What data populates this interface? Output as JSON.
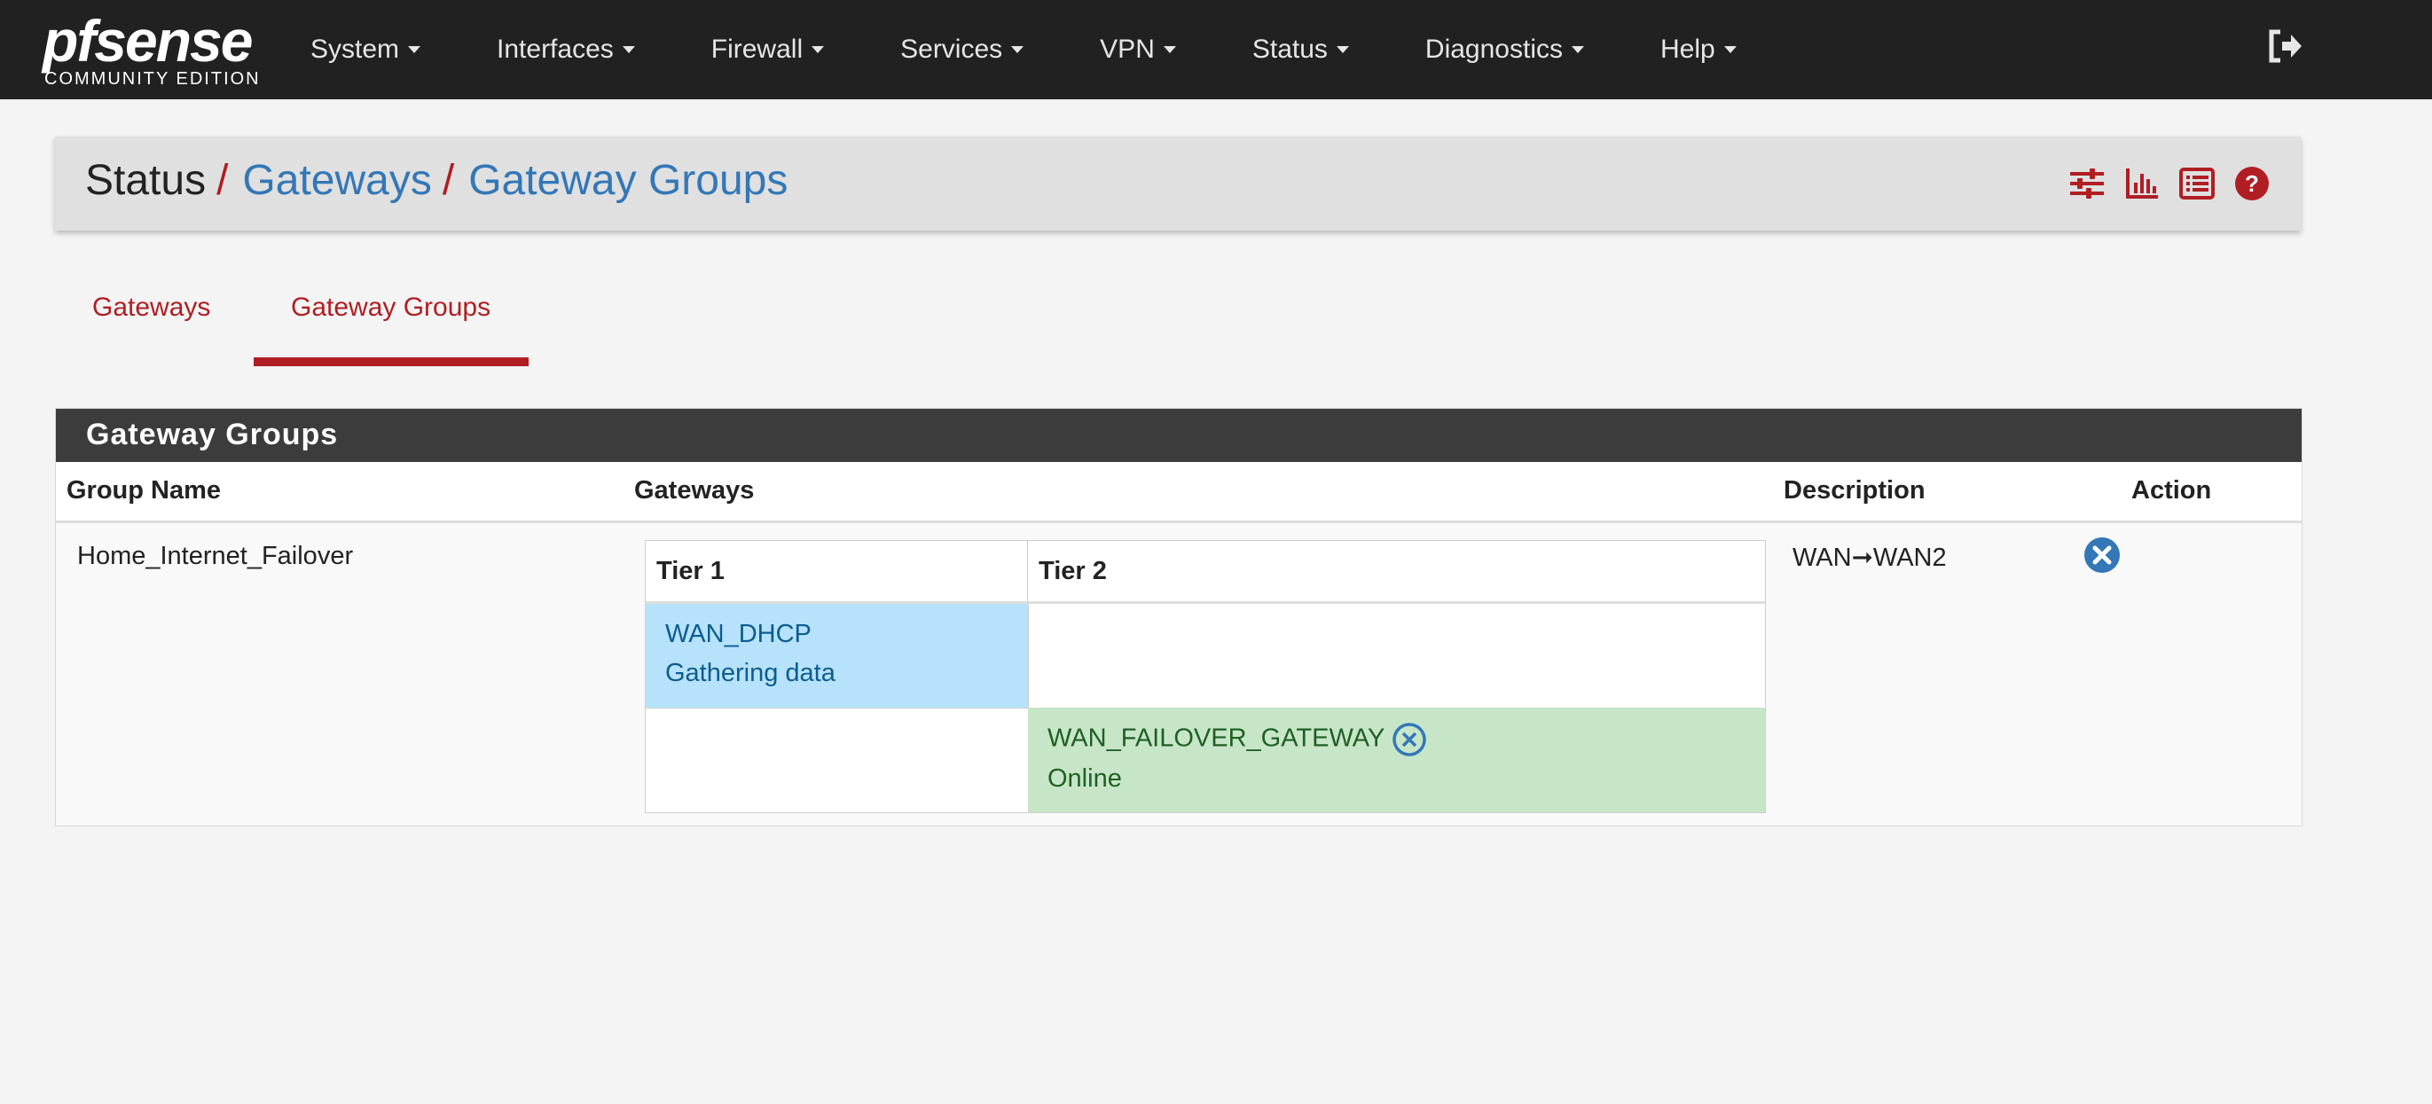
{
  "brand": {
    "logo_text_pf": "pf",
    "logo_text_sense": "sense",
    "logo_sub": "COMMUNITY EDITION"
  },
  "nav": {
    "items": [
      "System",
      "Interfaces",
      "Firewall",
      "Services",
      "VPN",
      "Status",
      "Diagnostics",
      "Help"
    ],
    "logout_icon": "sign-out-icon"
  },
  "breadcrumb": {
    "items": [
      "Status",
      "Gateways",
      "Gateway Groups"
    ],
    "separator": "/",
    "icons": [
      "sliders-icon",
      "bar-chart-icon",
      "list-icon",
      "help-icon"
    ]
  },
  "tabs": [
    {
      "label": "Gateways",
      "active": false
    },
    {
      "label": "Gateway Groups",
      "active": true
    }
  ],
  "panel": {
    "title": "Gateway Groups",
    "columns": [
      "Group Name",
      "Gateways",
      "Description",
      "Action"
    ],
    "rows": [
      {
        "group_name": "Home_Internet_Failover",
        "tiers": [
          "Tier 1",
          "Tier 2"
        ],
        "gateways": [
          {
            "name": "WAN_DHCP",
            "status": "Gathering data",
            "tier": 1
          },
          {
            "name": "WAN_FAILOVER_GATEWAY",
            "status": "Online",
            "tier": 2
          }
        ],
        "description_from": "WAN",
        "description_arrow": "➞",
        "description_to": "WAN2"
      }
    ]
  },
  "colors": {
    "accent": "#b01e23",
    "link": "#3377b7",
    "navbar": "#212121",
    "tier_blue": "#b6e3fb",
    "tier_green": "#c7e6c8",
    "online_text": "#1f5f24",
    "gathering_text": "#0d5c8e"
  }
}
